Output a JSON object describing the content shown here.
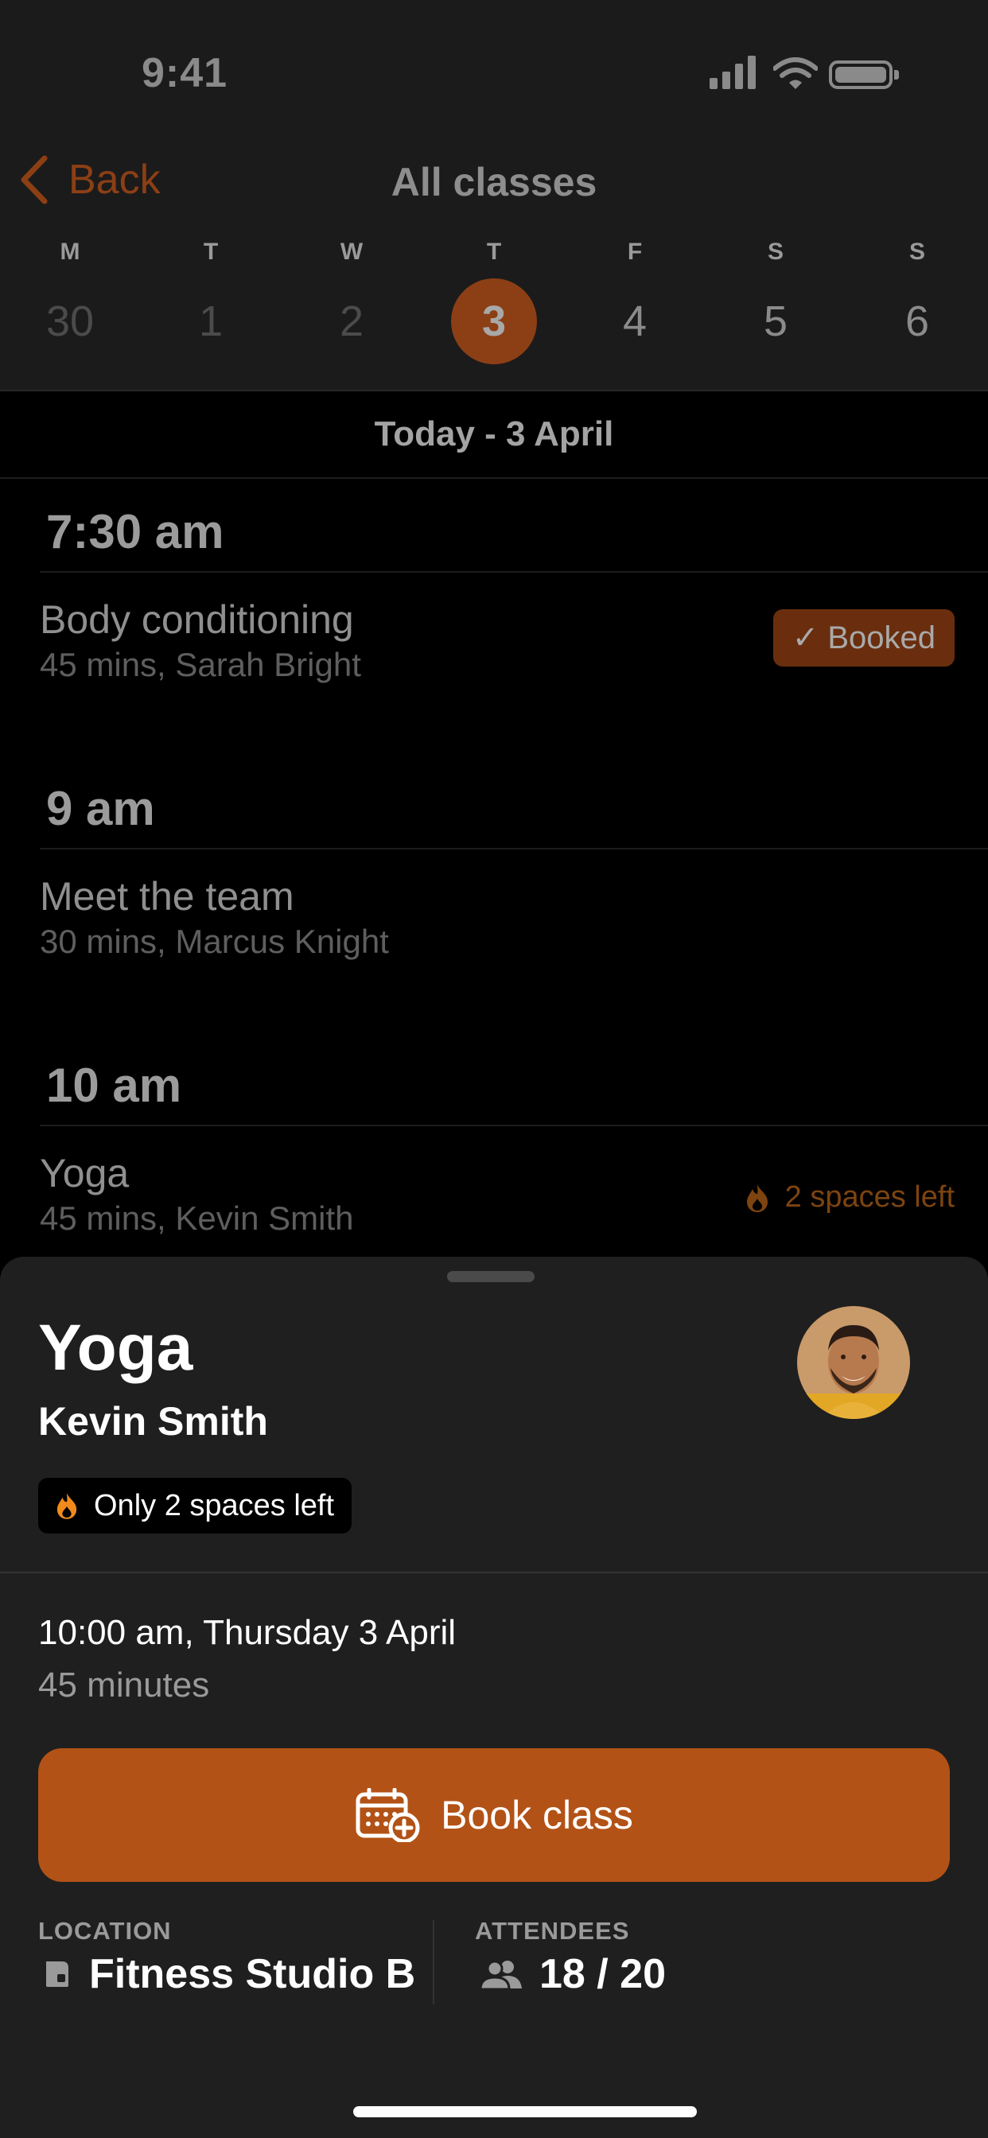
{
  "status_bar": {
    "time": "9:41"
  },
  "nav": {
    "back_label": "Back",
    "title": "All classes"
  },
  "week": [
    {
      "dow": "M",
      "num": "30",
      "state": "past"
    },
    {
      "dow": "T",
      "num": "1",
      "state": "past"
    },
    {
      "dow": "W",
      "num": "2",
      "state": "past"
    },
    {
      "dow": "T",
      "num": "3",
      "state": "selected"
    },
    {
      "dow": "F",
      "num": "4",
      "state": "future"
    },
    {
      "dow": "S",
      "num": "5",
      "state": "future"
    },
    {
      "dow": "S",
      "num": "6",
      "state": "future"
    }
  ],
  "section_header": "Today - 3 April",
  "schedule": [
    {
      "time": "7:30 am",
      "name": "Body conditioning",
      "meta": "45 mins, Sarah Bright",
      "badge": "Booked",
      "badge_type": "booked"
    },
    {
      "time": "9 am",
      "name": "Meet the team",
      "meta": "30 mins, Marcus Knight",
      "badge": "",
      "badge_type": "none"
    },
    {
      "time": "10 am",
      "name": "Yoga",
      "meta": "45 mins, Kevin Smith",
      "badge": "2 spaces left",
      "badge_type": "spaces"
    }
  ],
  "detail": {
    "title": "Yoga",
    "instructor": "Kevin Smith",
    "availability": "Only 2 spaces left",
    "datetime": "10:00 am, Thursday 3 April",
    "duration": "45 minutes",
    "book_label": "Book class",
    "location_label": "LOCATION",
    "location_value": "Fitness Studio B",
    "attendees_label": "ATTENDEES",
    "attendees_value": "18 / 20"
  },
  "colors": {
    "accent": "#b35216",
    "accent_dim": "#8c3f15",
    "booked_bg": "#6a2e0e",
    "flame": "#e07a1a"
  }
}
